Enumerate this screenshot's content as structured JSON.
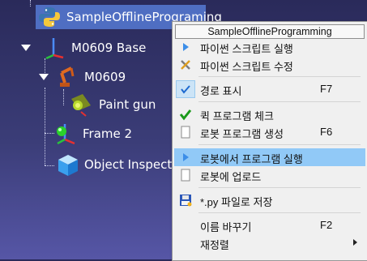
{
  "tree": {
    "root_label": "SampleOfflinePrograming",
    "items": [
      {
        "label": "M0609 Base"
      },
      {
        "label": "M0609"
      },
      {
        "label": "Paint gun"
      },
      {
        "label": "Frame 2"
      },
      {
        "label": "Object Inspection"
      }
    ]
  },
  "context_menu": {
    "title": "SampleOfflineProgramming",
    "items": [
      {
        "label": "파이썬 스크립트 실행",
        "icon": "play-icon"
      },
      {
        "label": "파이썬 스크립트 수정",
        "icon": "edit-icon"
      },
      {
        "label": "경로 표시",
        "shortcut": "F7",
        "icon": "check-icon",
        "checked": true
      },
      {
        "label": "퀵 프로그램 체크",
        "icon": "green-check-icon"
      },
      {
        "label": "로봇 프로그램 생성",
        "shortcut": "F6",
        "icon": "document-icon"
      },
      {
        "label": "로봇에서 프로그램 실행",
        "icon": "play-icon",
        "highlighted": true
      },
      {
        "label": "로봇에 업로드",
        "icon": "document-icon"
      },
      {
        "label": "*.py 파일로 저장",
        "icon": "save-icon"
      },
      {
        "label": "이름 바꾸기",
        "shortcut": "F2"
      },
      {
        "label": "재정렬",
        "has_submenu": true
      }
    ]
  },
  "colors": {
    "background_top": "#2a2a5a",
    "background_bottom": "#5656a6",
    "selection": "#4f6ec2",
    "menu_highlight": "#91c9f7",
    "menu_bg": "#f0f0f0"
  }
}
